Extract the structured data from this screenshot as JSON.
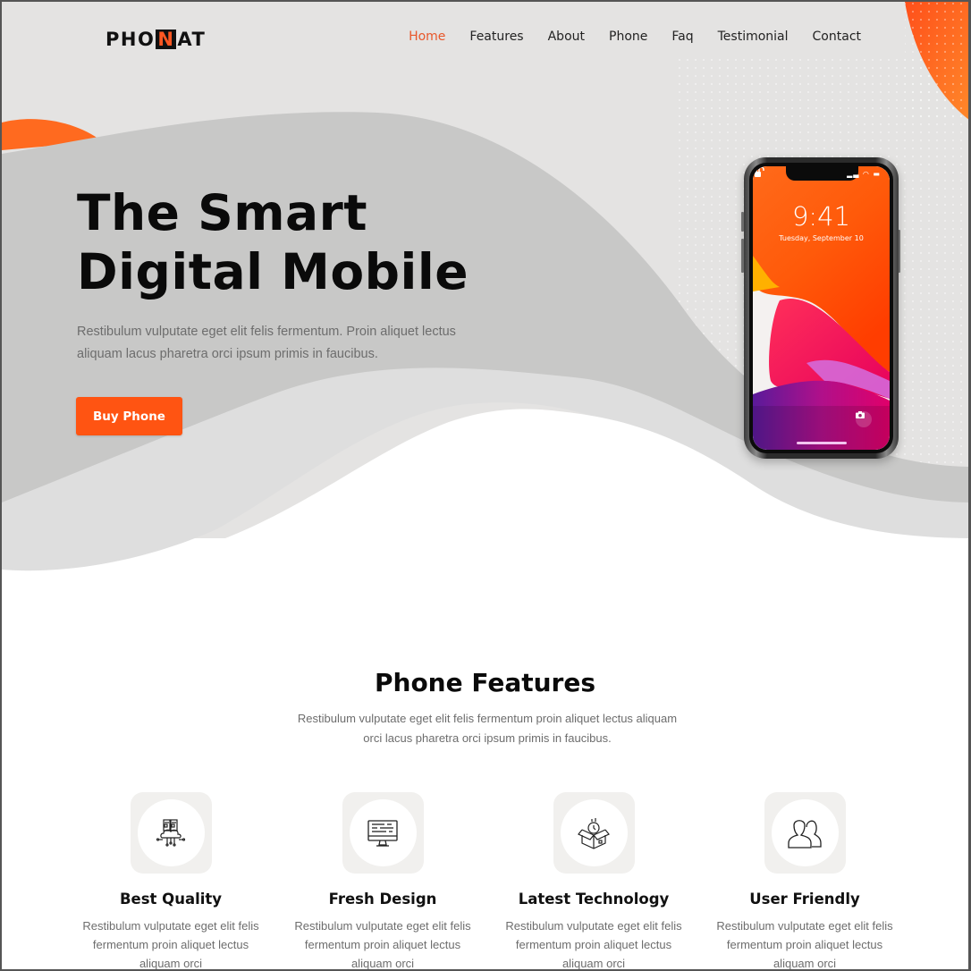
{
  "brand": {
    "logo_pre": "PHO",
    "logo_highlight": "N",
    "logo_post": "AT",
    "accent_color": "#ff5412"
  },
  "nav": {
    "items": [
      {
        "label": "Home",
        "active": true
      },
      {
        "label": "Features",
        "active": false
      },
      {
        "label": "About",
        "active": false
      },
      {
        "label": "Phone",
        "active": false
      },
      {
        "label": "Faq",
        "active": false
      },
      {
        "label": "Testimonial",
        "active": false
      },
      {
        "label": "Contact",
        "active": false
      }
    ]
  },
  "hero": {
    "title_line1": "The Smart",
    "title_line2": "Digital Mobile",
    "description": "Restibulum vulputate eget elit felis fermentum. Proin aliquet lectus aliquam lacus pharetra orci ipsum primis in faucibus.",
    "cta_label": "Buy Phone"
  },
  "phone_mockup": {
    "time": "9:41",
    "date": "Tuesday, September 10",
    "status_icons": "signal wifi battery",
    "lock_icon": "unlocked-padlock",
    "left_shortcut_icon": "flashlight",
    "right_shortcut_icon": "camera"
  },
  "features_section": {
    "title": "Phone Features",
    "description": "Restibulum vulputate eget elit felis fermentum proin aliquet lectus aliquam orci lacus pharetra orci ipsum primis in faucibus.",
    "items": [
      {
        "icon": "cloud-server-icon",
        "title": "Best Quality",
        "description": "Restibulum vulputate eget elit felis fermentum proin aliquet lectus aliquam orci"
      },
      {
        "icon": "monitor-icon",
        "title": "Fresh Design",
        "description": "Restibulum vulputate eget elit felis fermentum proin aliquet lectus aliquam orci"
      },
      {
        "icon": "box-clock-icon",
        "title": "Latest Technology",
        "description": "Restibulum vulputate eget elit felis fermentum proin aliquet lectus aliquam orci"
      },
      {
        "icon": "users-icon",
        "title": "User Friendly",
        "description": "Restibulum vulputate eget elit felis fermentum proin aliquet lectus aliquam orci"
      }
    ]
  }
}
